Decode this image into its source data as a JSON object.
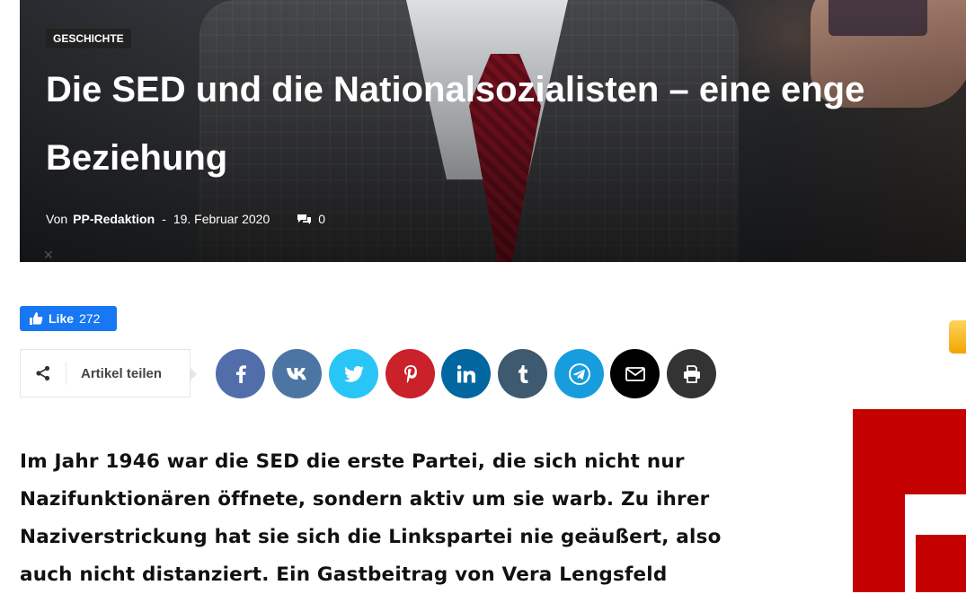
{
  "article": {
    "category": "GESCHICHTE",
    "title": "Die SED und die Nationalsozialisten – eine enge Beziehung",
    "by_label": "Von",
    "author": "PP-Redaktion",
    "separator": "-",
    "date": "19. Februar 2020",
    "comment_count": "0",
    "lead": "Im Jahr 1946 war die SED die erste Partei, die sich nicht nur Nazifunktionären öffnete, sondern aktiv um sie warb. Zu ihrer Naziverstrickung hat sie sich die Linkspartei nie geäußert, also auch nicht distanziert. Ein Gastbeitrag von Vera Lengsfeld"
  },
  "like_widget": {
    "label": "Like",
    "count": "272"
  },
  "share": {
    "label": "Artikel teilen",
    "buttons": [
      {
        "name": "facebook",
        "icon": "facebook-icon",
        "color": "#516eab"
      },
      {
        "name": "vk",
        "icon": "vk-icon",
        "color": "#4c75a3"
      },
      {
        "name": "twitter",
        "icon": "twitter-icon",
        "color": "#29c5f6"
      },
      {
        "name": "pinterest",
        "icon": "pinterest-icon",
        "color": "#ca212a"
      },
      {
        "name": "linkedin",
        "icon": "linkedin-icon",
        "color": "#0266a0"
      },
      {
        "name": "tumblr",
        "icon": "tumblr-icon",
        "color": "#3e5a70"
      },
      {
        "name": "telegram",
        "icon": "telegram-icon",
        "color": "#179cde"
      },
      {
        "name": "email",
        "icon": "email-icon",
        "color": "#000000"
      },
      {
        "name": "print",
        "icon": "print-icon",
        "color": "#333333"
      }
    ]
  },
  "colors": {
    "like_blue": "#1877f2",
    "category_bg": "#222222",
    "ad_red": "#c40000",
    "ad_orange": "#f2a500"
  }
}
